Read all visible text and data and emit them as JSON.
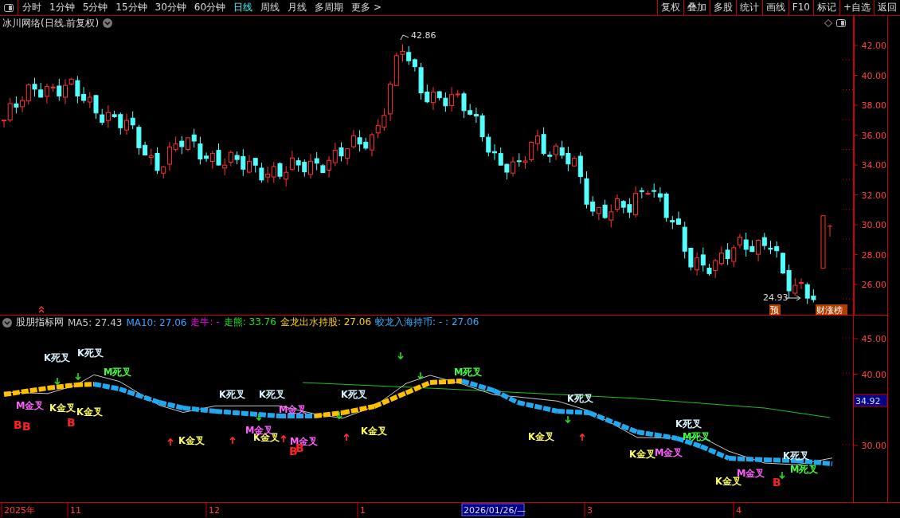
{
  "toolbar": {
    "periods": [
      {
        "label": "分时",
        "selected": false
      },
      {
        "label": "1分钟",
        "selected": false
      },
      {
        "label": "5分钟",
        "selected": false
      },
      {
        "label": "15分钟",
        "selected": false
      },
      {
        "label": "30分钟",
        "selected": false
      },
      {
        "label": "60分钟",
        "selected": false
      },
      {
        "label": "日线",
        "selected": true
      },
      {
        "label": "周线",
        "selected": false
      },
      {
        "label": "月线",
        "selected": false
      },
      {
        "label": "多周期",
        "selected": false
      },
      {
        "label": "更多 >",
        "selected": false
      }
    ],
    "actions": [
      "复权",
      "叠加",
      "多股",
      "统计",
      "画线",
      "F10",
      "标记",
      "+自选",
      "返回"
    ]
  },
  "main_chart": {
    "title": "冰川网络(日线.前复权)",
    "price_labels": [
      {
        "text": "42.86",
        "kind": "high"
      },
      {
        "text": "24.93",
        "kind": "low"
      }
    ],
    "badges": [
      {
        "text": "预",
        "kind": "forecast"
      },
      {
        "text": "财涨榜",
        "kind": "rank"
      }
    ],
    "y_axis": [
      "42.00",
      "40.00",
      "38.00",
      "36.00",
      "34.00",
      "32.00",
      "30.00",
      "28.00",
      "26.00"
    ]
  },
  "indicator_panel": {
    "name": "股朋指标网",
    "legend": [
      {
        "text": "MA5: 27.43",
        "color": "#c8c8c8"
      },
      {
        "text": "MA10: 27.06",
        "color": "#3aa0ff"
      },
      {
        "text": "走牛: -",
        "color": "#ff00ff"
      },
      {
        "text": "走熊: 33.76",
        "color": "#20e020"
      },
      {
        "text": "金龙出水持股: 27.06",
        "color": "#ffd000"
      },
      {
        "text": "蛟龙入海持币: - : 27.06",
        "color": "#30b0ff"
      }
    ],
    "signals": [
      {
        "text": "K死叉",
        "color": "#d8f4ff"
      },
      {
        "text": "K死叉",
        "color": "#d8f4ff"
      },
      {
        "text": "M死叉",
        "color": "#40ff40"
      },
      {
        "text": "M金叉",
        "color": "#ff60ff"
      },
      {
        "text": "K金叉",
        "color": "#ffff60"
      },
      {
        "text": "K金叉",
        "color": "#ffff60"
      },
      {
        "text": "B",
        "color": "#ff2020"
      },
      {
        "text": "B",
        "color": "#ff2020"
      },
      {
        "text": "B",
        "color": "#ff2020"
      },
      {
        "text": "K死叉",
        "color": "#d8f4ff"
      },
      {
        "text": "K死叉",
        "color": "#d8f4ff"
      },
      {
        "text": "K死叉",
        "color": "#d8f4ff"
      },
      {
        "text": "M金叉",
        "color": "#ff60ff"
      },
      {
        "text": "K金叉",
        "color": "#ffff60"
      },
      {
        "text": "M金叉",
        "color": "#ff60ff"
      },
      {
        "text": "K金叉",
        "color": "#ffff60"
      },
      {
        "text": "M金叉",
        "color": "#ff60ff"
      },
      {
        "text": "B",
        "color": "#ff2020"
      },
      {
        "text": "B",
        "color": "#ff2020"
      },
      {
        "text": "K金叉",
        "color": "#ffff60"
      },
      {
        "text": "M死叉",
        "color": "#40ff40"
      },
      {
        "text": "K死叉",
        "color": "#d8f4ff"
      },
      {
        "text": "K金叉",
        "color": "#ffff60"
      },
      {
        "text": "K金叉",
        "color": "#ffff60"
      },
      {
        "text": "M金叉",
        "color": "#ff60ff"
      },
      {
        "text": "K死叉",
        "color": "#d8f4ff"
      },
      {
        "text": "M死叉",
        "color": "#40ff40"
      },
      {
        "text": "K金叉",
        "color": "#ffff60"
      },
      {
        "text": "M金叉",
        "color": "#ff60ff"
      },
      {
        "text": "K死叉",
        "color": "#d8f4ff"
      },
      {
        "text": "M死叉",
        "color": "#40ff40"
      },
      {
        "text": "B",
        "color": "#ff2020"
      }
    ],
    "y_axis": [
      "45.00",
      "40.00",
      "30.00"
    ],
    "current_value": "34.92"
  },
  "time_axis": {
    "labels": [
      "2025年",
      "11",
      "12",
      "1",
      "3",
      "4"
    ],
    "cursor_date": "2026/01/26/—"
  }
}
